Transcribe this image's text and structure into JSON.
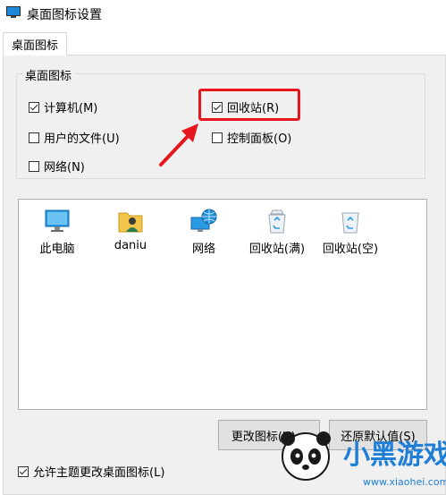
{
  "window": {
    "title": "桌面图标设置"
  },
  "tabs": [
    {
      "label": "桌面图标"
    }
  ],
  "group": {
    "label": "桌面图标",
    "checkboxes": [
      {
        "label": "计算机(M)",
        "checked": true
      },
      {
        "label": "回收站(R)",
        "checked": true
      },
      {
        "label": "用户的文件(U)",
        "checked": false
      },
      {
        "label": "控制面板(O)",
        "checked": false
      },
      {
        "label": "网络(N)",
        "checked": false
      }
    ]
  },
  "icons": [
    {
      "label": "此电脑",
      "icon": "monitor-icon"
    },
    {
      "label": "daniu",
      "icon": "user-folder-icon"
    },
    {
      "label": "网络",
      "icon": "network-globe-icon"
    },
    {
      "label": "回收站(满)",
      "icon": "recycle-bin-full-icon"
    },
    {
      "label": "回收站(空)",
      "icon": "recycle-bin-empty-icon"
    }
  ],
  "buttons": {
    "change_icon": "更改图标(H)...",
    "restore_default": "还原默认值(S)"
  },
  "theme_option": {
    "label": "允许主题更改桌面图标(L)",
    "checked": true
  },
  "watermark": {
    "brand": "小黑游戏",
    "url": "www.xiaohei.com"
  },
  "colors": {
    "highlight_red": "#e5161d",
    "panel_bg": "#f0f0f0"
  }
}
